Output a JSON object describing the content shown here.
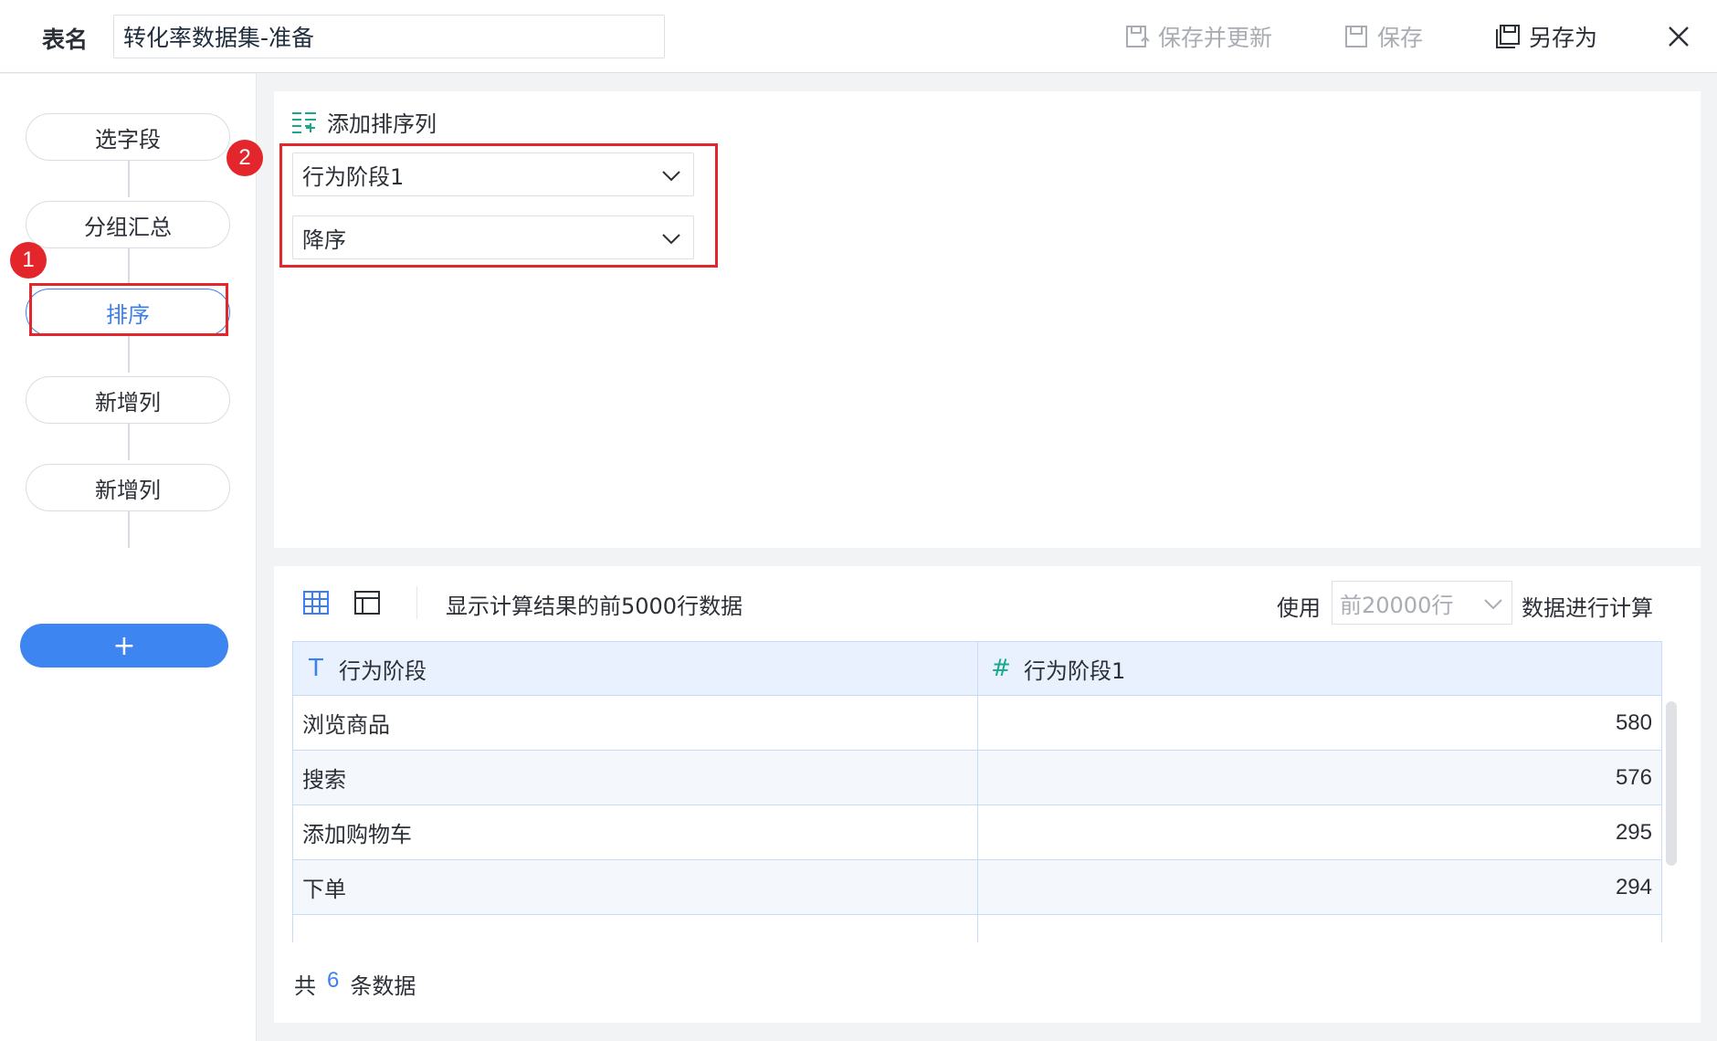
{
  "header": {
    "table_name_label": "表名",
    "table_name_value": "转化率数据集-准备",
    "save_update_label": "保存并更新",
    "save_label": "保存",
    "save_as_label": "另存为",
    "close_icon": "close-icon"
  },
  "sidebar": {
    "steps": [
      {
        "label": "选字段"
      },
      {
        "label": "分组汇总"
      },
      {
        "label": "排序"
      },
      {
        "label": "新增列"
      },
      {
        "label": "新增列"
      }
    ],
    "add_label": "+",
    "active_index": 2
  },
  "annotations": {
    "badge_1": "1",
    "badge_2": "2",
    "highlight_color": "#e3262b"
  },
  "sort_panel": {
    "add_sort_label": "添加排序列",
    "field_select": "行为阶段1",
    "order_select": "降序"
  },
  "data_panel": {
    "preview_text": "显示计算结果的前5000行数据",
    "use_label": "使用",
    "row_limit_placeholder": "前20000行",
    "calc_label": "数据进行计算",
    "columns": [
      {
        "type_icon": "T",
        "name": "行为阶段"
      },
      {
        "type_icon": "#",
        "name": "行为阶段1"
      }
    ],
    "rows": [
      {
        "c1": "浏览商品",
        "c2": "580"
      },
      {
        "c1": "搜索",
        "c2": "576"
      },
      {
        "c1": "添加购物车",
        "c2": "295"
      },
      {
        "c1": "下单",
        "c2": "294"
      }
    ],
    "total_prefix": "共",
    "total_count": "6",
    "total_suffix": "条数据"
  },
  "colors": {
    "accent": "#3d7ff0",
    "text_type_icon": "#3d7ff0",
    "num_type_icon": "#19a88e"
  }
}
